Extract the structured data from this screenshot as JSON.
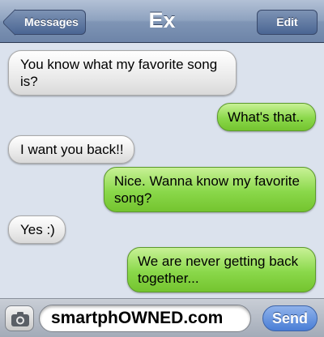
{
  "navbar": {
    "back_label": "Messages",
    "title": "Ex",
    "edit_label": "Edit"
  },
  "messages": [
    {
      "direction": "incoming",
      "text": "You know what my favorite song is?"
    },
    {
      "direction": "outgoing",
      "text": "What's that.."
    },
    {
      "direction": "incoming",
      "text": "I want you back!!"
    },
    {
      "direction": "outgoing",
      "text": "Nice. Wanna know my favorite song?"
    },
    {
      "direction": "incoming",
      "text": "Yes :)"
    },
    {
      "direction": "outgoing",
      "text": "We are never getting back together..."
    }
  ],
  "input_bar": {
    "camera_icon": "camera-icon",
    "field_text": "smartphOWNED.com",
    "send_label": "Send"
  },
  "colors": {
    "incoming_bubble": "#e6e6e6",
    "outgoing_bubble": "#8ad84a",
    "background": "#dbe2ed",
    "send_button": "#4a7ed6"
  }
}
